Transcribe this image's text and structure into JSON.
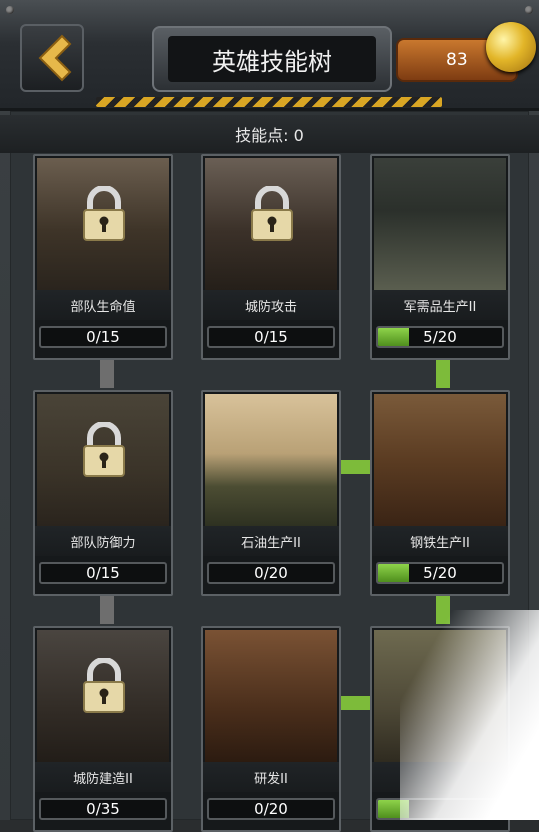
{
  "header": {
    "title": "英雄技能树",
    "coins": "83",
    "back_icon": "chevron-left-icon",
    "coin_icon": "gold-coin-icon"
  },
  "skill_points": "技能点: 0",
  "colors": {
    "accent_green": "#7dbb3a",
    "coin_orange": "#c9782e",
    "hazard_yellow": "#d9a624"
  },
  "skills": [
    {
      "name": "部队生命值",
      "progress": "0/15",
      "level": 0,
      "max": 15,
      "locked": true,
      "scene": "medical"
    },
    {
      "name": "城防攻击",
      "progress": "0/15",
      "level": 0,
      "max": 15,
      "locked": true,
      "scene": "ruins"
    },
    {
      "name": "军需品生产II",
      "progress": "5/20",
      "level": 5,
      "max": 20,
      "locked": false,
      "scene": "ammo-crate"
    },
    {
      "name": "部队防御力",
      "progress": "0/15",
      "level": 0,
      "max": 15,
      "locked": true,
      "scene": "soldiers"
    },
    {
      "name": "石油生产II",
      "progress": "0/20",
      "level": 0,
      "max": 20,
      "locked": false,
      "scene": "oil-barrels"
    },
    {
      "name": "钢铁生产II",
      "progress": "5/20",
      "level": 5,
      "max": 20,
      "locked": false,
      "scene": "mine-cart"
    },
    {
      "name": "城防建造II",
      "progress": "0/35",
      "level": 0,
      "max": 35,
      "locked": true,
      "scene": "rubble"
    },
    {
      "name": "研发II",
      "progress": "0/20",
      "level": 0,
      "max": 20,
      "locked": false,
      "scene": "scientist"
    },
    {
      "name": "",
      "progress": "",
      "level": 5,
      "max": 20,
      "locked": false,
      "scene": "money"
    }
  ]
}
